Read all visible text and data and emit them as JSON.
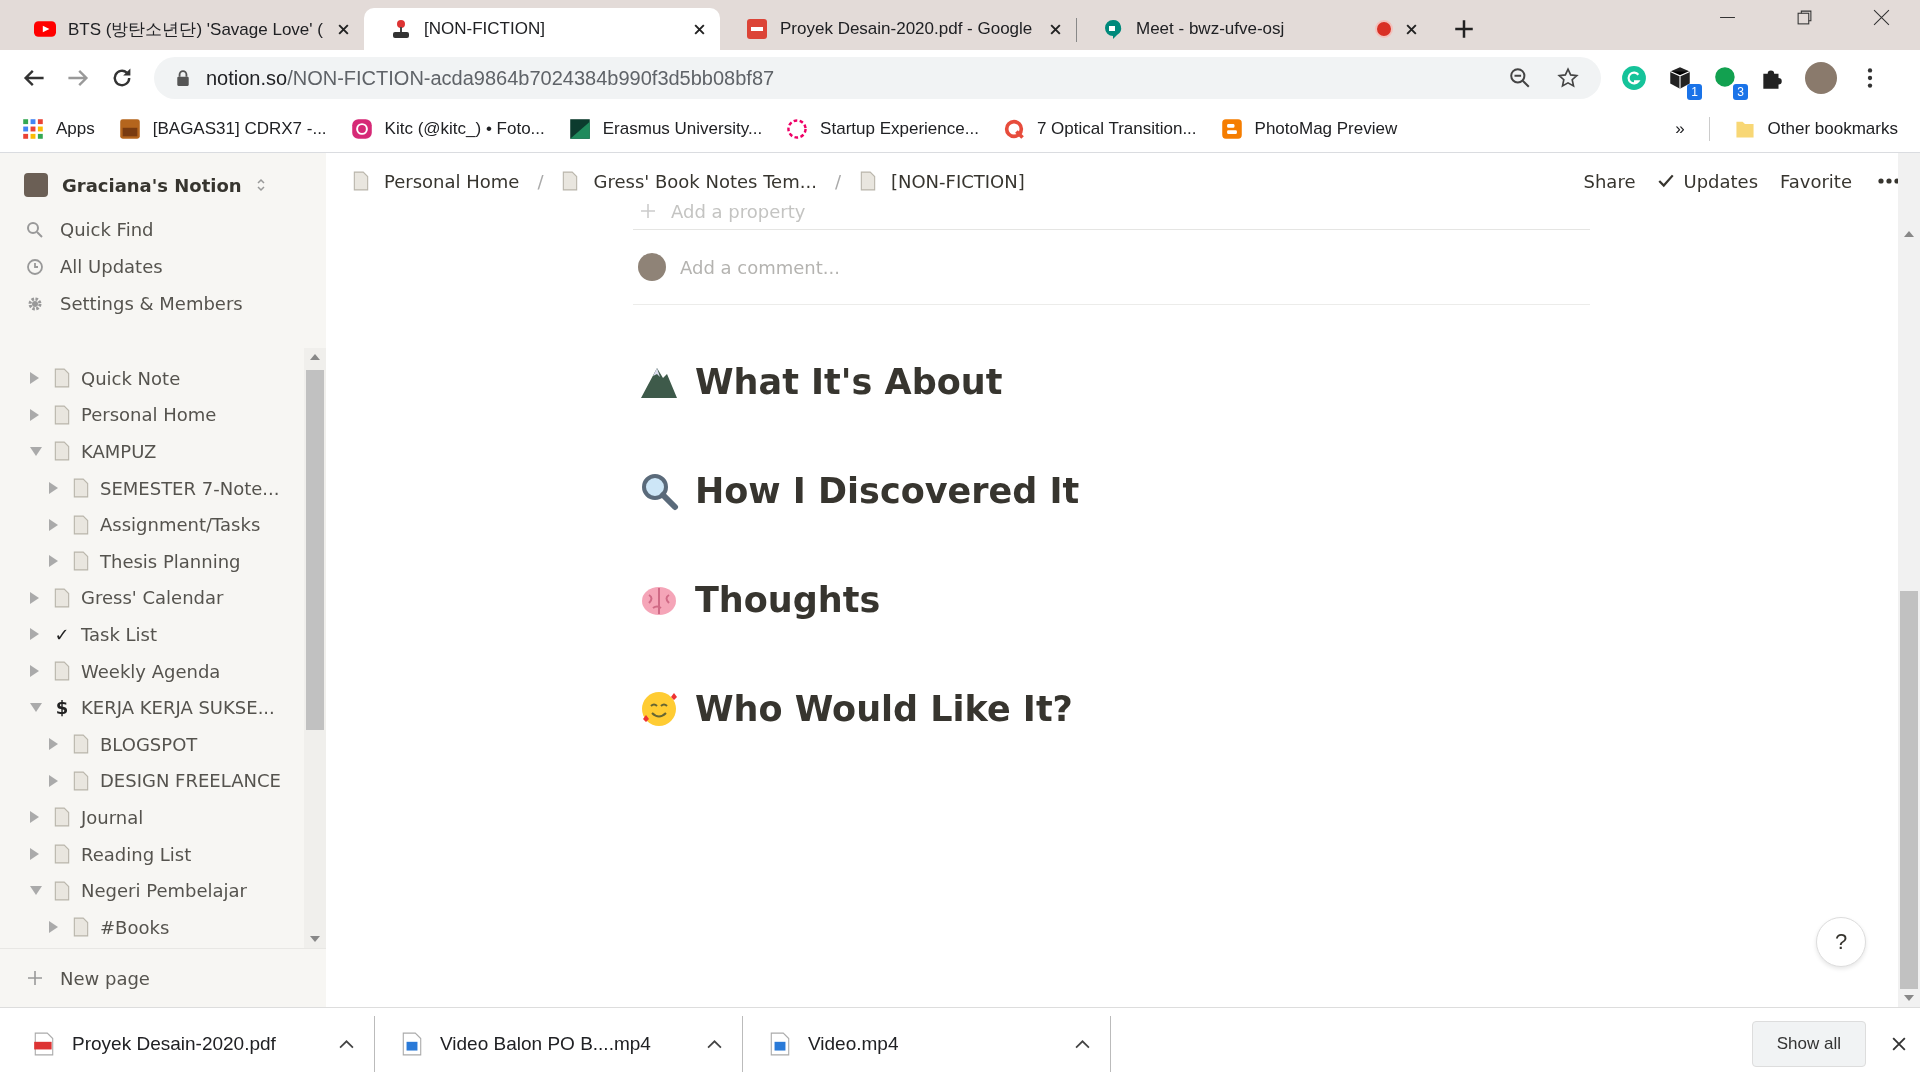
{
  "tabs": [
    {
      "title": "BTS (방탄소년단) 'Savage Love' (",
      "kind": "video",
      "selected": false,
      "recording": false
    },
    {
      "title": "[NON-FICTION]",
      "kind": "joystick",
      "selected": true,
      "recording": false
    },
    {
      "title": "Proyek Desain-2020.pdf - Google",
      "kind": "pdf",
      "selected": false,
      "recording": false
    },
    {
      "title": "Meet - bwz-ufve-osj",
      "kind": "meet",
      "selected": false,
      "recording": true
    }
  ],
  "address": {
    "host": "notion.so",
    "path": "/NON-FICTION-acda9864b7024384b990f3d5bb08bf87"
  },
  "extension_badges": [
    "1",
    "3"
  ],
  "bookmarks": [
    {
      "label": "Apps",
      "kind": "grid"
    },
    {
      "label": "[BAGAS31] CDRX7 -...",
      "kind": "box"
    },
    {
      "label": "Kitc (@kitc_) • Foto...",
      "kind": "camera"
    },
    {
      "label": "Erasmus University...",
      "kind": "flag"
    },
    {
      "label": "Startup Experience...",
      "kind": "ring"
    },
    {
      "label": "7 Optical Transition...",
      "kind": "q"
    },
    {
      "label": "PhotoMag Preview",
      "kind": "blog"
    }
  ],
  "bookmarks_overflow": "»",
  "other_bookmarks": "Other bookmarks",
  "sidebar": {
    "workspace": "Graciana's Notion",
    "nav": [
      {
        "label": "Quick Find",
        "kind": "search"
      },
      {
        "label": "All Updates",
        "kind": "clock"
      },
      {
        "label": "Settings & Members",
        "kind": "gear"
      }
    ],
    "tree": [
      {
        "label": "Quick Note",
        "expanded": false
      },
      {
        "label": "Personal Home",
        "expanded": false
      },
      {
        "label": "KAMPUZ",
        "expanded": true,
        "children": [
          {
            "label": "SEMESTER 7-Note...",
            "expanded": false
          },
          {
            "label": "Assignment/Tasks",
            "expanded": false
          },
          {
            "label": "Thesis Planning",
            "expanded": false
          }
        ]
      },
      {
        "label": "Gress' Calendar",
        "expanded": false
      },
      {
        "label": "Task List",
        "expanded": false,
        "glyph": "✓"
      },
      {
        "label": "Weekly Agenda",
        "expanded": false
      },
      {
        "label": "KERJA KERJA SUKSE...",
        "expanded": true,
        "glyph": "$",
        "children": [
          {
            "label": "BLOGSPOT",
            "expanded": false
          },
          {
            "label": "DESIGN FREELANCE",
            "expanded": false
          }
        ]
      },
      {
        "label": "Journal",
        "expanded": false
      },
      {
        "label": "Reading List",
        "expanded": false
      },
      {
        "label": "Negeri Pembelajar",
        "expanded": true,
        "children": [
          {
            "label": "#Books",
            "expanded": false
          }
        ]
      }
    ],
    "new_page": "New page"
  },
  "breadcrumb": [
    {
      "label": "Personal Home"
    },
    {
      "label": "Gress' Book Notes Tem..."
    },
    {
      "label": "[NON-FICTION]"
    }
  ],
  "breadcrumb_separator": "/",
  "topbar_actions": [
    "Share",
    "Updates",
    "Favorite"
  ],
  "page": {
    "add_property": "Add a property",
    "comment_placeholder": "Add a comment...",
    "headings": [
      {
        "text": "What It's About",
        "kind": "mountain"
      },
      {
        "text": "How I Discovered It",
        "kind": "magnifier"
      },
      {
        "text": "Thoughts",
        "kind": "brain"
      },
      {
        "text": "Who Would Like It?",
        "kind": "smiley"
      }
    ]
  },
  "help": "?",
  "downloads": [
    {
      "name": "Proyek Desain-2020.pdf",
      "kind": "pdf"
    },
    {
      "name": "Video Balon PO B....mp4",
      "kind": "video"
    },
    {
      "name": "Video.mp4",
      "kind": "video"
    }
  ],
  "show_all": "Show all"
}
